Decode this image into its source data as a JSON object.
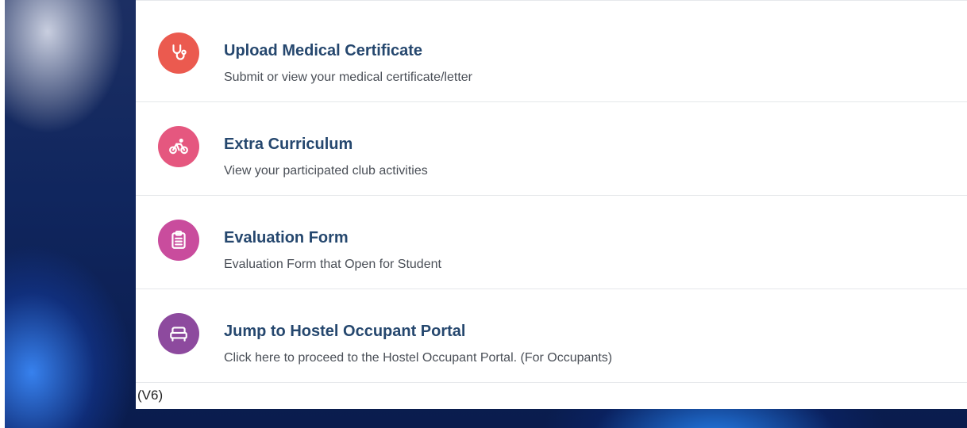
{
  "menu": {
    "items": [
      {
        "title": "Upload Medical Certificate",
        "subtitle": "Submit or view your medical certificate/letter",
        "icon": "stethoscope-icon",
        "color": "#eb5a4f"
      },
      {
        "title": "Extra Curriculum",
        "subtitle": "View your participated club activities",
        "icon": "bicycle-icon",
        "color": "#e5577f"
      },
      {
        "title": "Evaluation Form",
        "subtitle": "Evaluation Form that Open for Student",
        "icon": "clipboard-icon",
        "color": "#c94c9d"
      },
      {
        "title": "Jump to Hostel Occupant Portal",
        "subtitle": "Click here to proceed to the Hostel Occupant Portal. (For Occupants)",
        "icon": "bed-icon",
        "color": "#8d4a9e"
      }
    ]
  },
  "footer": {
    "version": "(V6)"
  }
}
